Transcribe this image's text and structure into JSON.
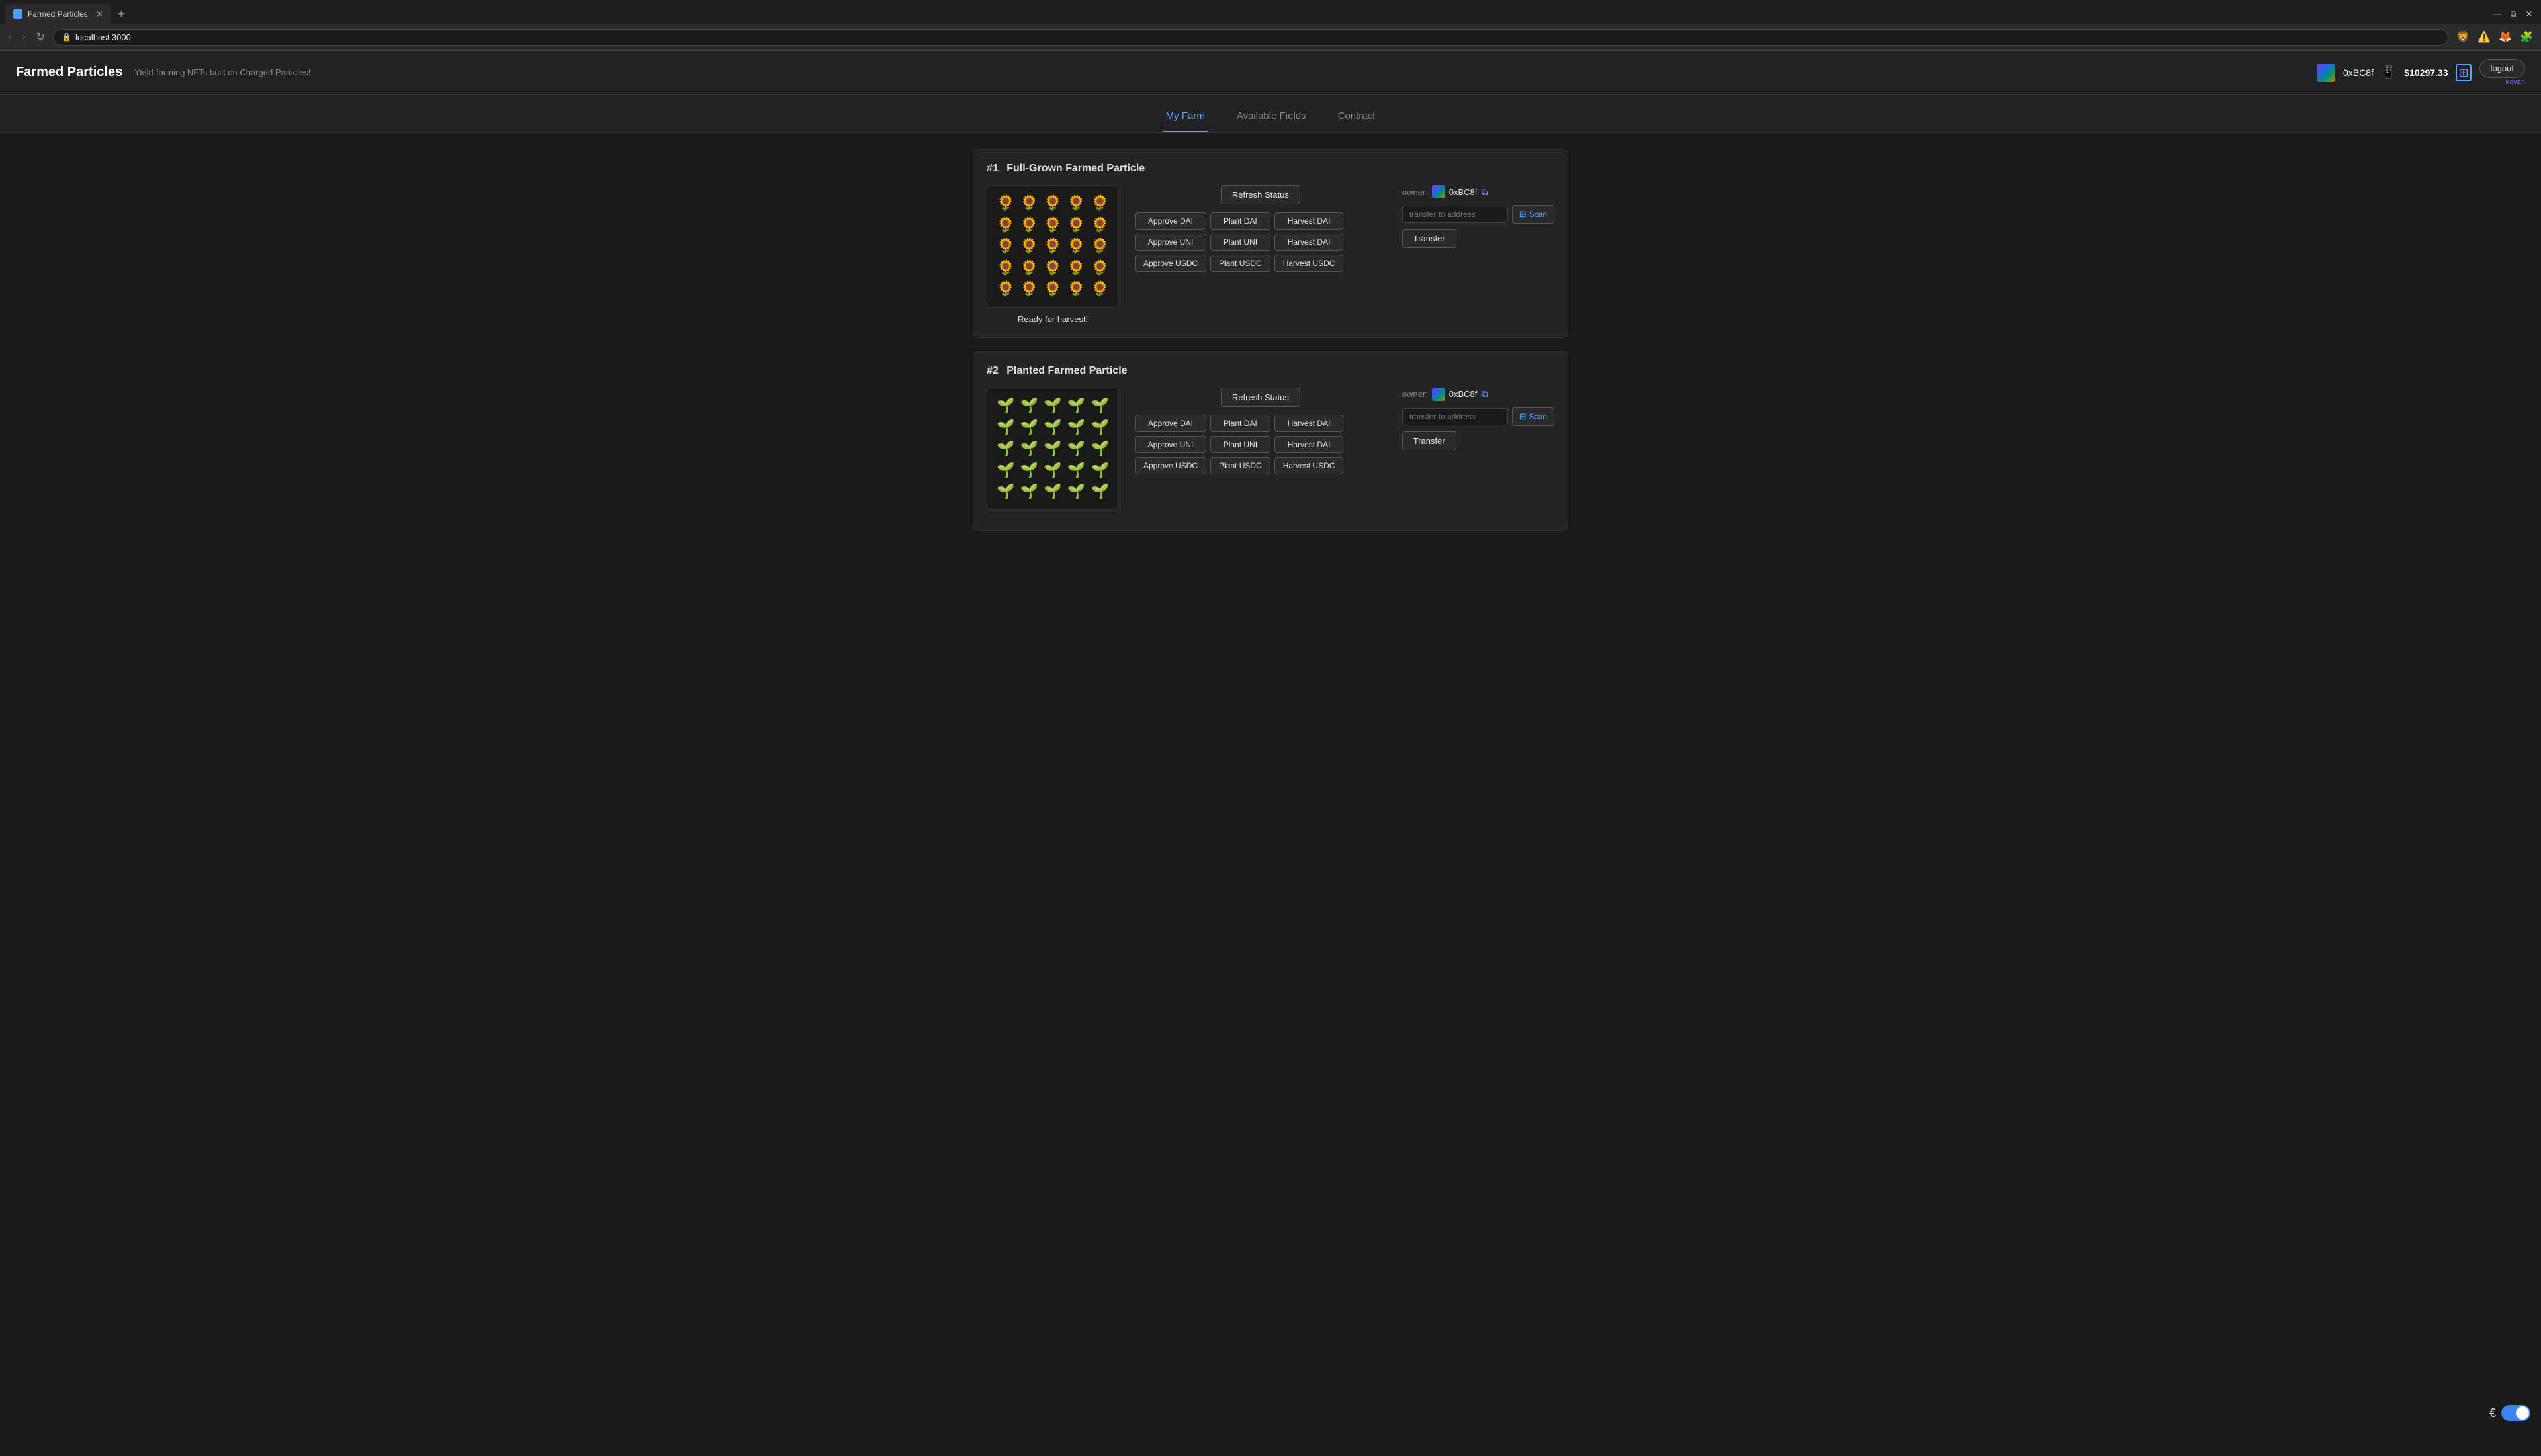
{
  "browser": {
    "tab_title": "Farmed Particles",
    "tab_favicon": "🌱",
    "new_tab_icon": "+",
    "address": "localhost:3000",
    "extensions": [
      "🦁",
      "⚠️",
      "🦊",
      "🧩"
    ],
    "back_btn": "‹",
    "forward_btn": "›",
    "reload_btn": "↻",
    "window_minimize": "—",
    "window_restore": "⧉",
    "window_close": "✕"
  },
  "app": {
    "title": "Farmed Particles",
    "subtitle": "Yield-farming NFTs built on Charged Particles!",
    "wallet_address": "0xBC8f",
    "wallet_balance": "$10297.33",
    "network": "kovan",
    "logout_label": "logout"
  },
  "nav": {
    "tabs": [
      {
        "label": "My Farm",
        "active": true
      },
      {
        "label": "Available Fields",
        "active": false
      },
      {
        "label": "Contract",
        "active": false
      }
    ]
  },
  "particles": [
    {
      "id": "#1",
      "type": "Full-Grown Farmed Particle",
      "emoji": "🌻",
      "grid_count": 25,
      "status_text": "Ready for harvest!",
      "refresh_label": "Refresh Status",
      "actions": [
        {
          "label": "Approve DAI"
        },
        {
          "label": "Plant DAI"
        },
        {
          "label": "Harvest DAI"
        },
        {
          "label": "Approve UNI"
        },
        {
          "label": "Plant UNI"
        },
        {
          "label": "Harvest DAI"
        },
        {
          "label": "Approve USDC"
        },
        {
          "label": "Plant USDC"
        },
        {
          "label": "Harvest USDC"
        }
      ],
      "owner_label": "owner:",
      "owner_address": "0xBC8f",
      "transfer_placeholder": "transfer to address",
      "scan_label": "Scan",
      "transfer_label": "Transfer"
    },
    {
      "id": "#2",
      "type": "Planted Farmed Particle",
      "emoji": "🌱",
      "grid_count": 25,
      "status_text": "",
      "refresh_label": "Refresh Status",
      "actions": [
        {
          "label": "Approve DAI"
        },
        {
          "label": "Plant DAI"
        },
        {
          "label": "Harvest DAI"
        },
        {
          "label": "Approve UNI"
        },
        {
          "label": "Plant UNI"
        },
        {
          "label": "Harvest DAI"
        },
        {
          "label": "Approve USDC"
        },
        {
          "label": "Plant USDC"
        },
        {
          "label": "Harvest USDC"
        }
      ],
      "owner_label": "owner:",
      "owner_address": "0xBC8f",
      "transfer_placeholder": "transfer to address",
      "scan_label": "Scan",
      "transfer_label": "Transfer"
    }
  ],
  "bottom": {
    "coin_icon": "€"
  }
}
